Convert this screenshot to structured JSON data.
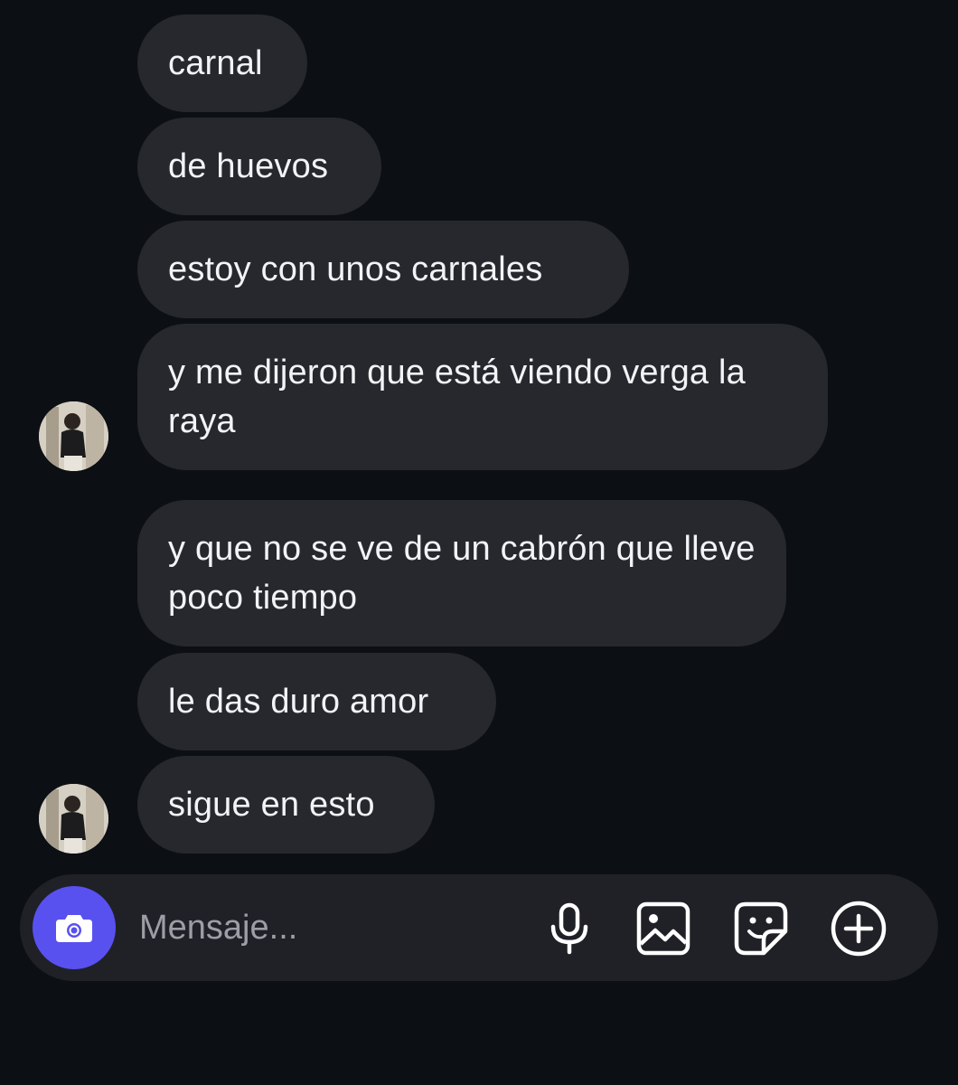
{
  "messages": [
    {
      "text": "carnal"
    },
    {
      "text": "de huevos"
    },
    {
      "text": "estoy con unos carnales"
    },
    {
      "text": "y me dijeron que está viendo verga la raya"
    },
    {
      "text": "y que no se ve de un cabrón que lleve poco tiempo"
    },
    {
      "text": "le das duro amor"
    },
    {
      "text": "sigue en esto"
    }
  ],
  "composer": {
    "placeholder": "Mensaje...",
    "camera_icon": "camera-icon",
    "tools": [
      "microphone-icon",
      "image-icon",
      "sticker-icon",
      "plus-circle-icon"
    ]
  },
  "colors": {
    "background": "#0c0f14",
    "bubble": "#26282e",
    "composer": "#1f2127",
    "accent": "#5851f0",
    "text": "#f2f3f5",
    "placeholder": "#9b9ea6"
  }
}
